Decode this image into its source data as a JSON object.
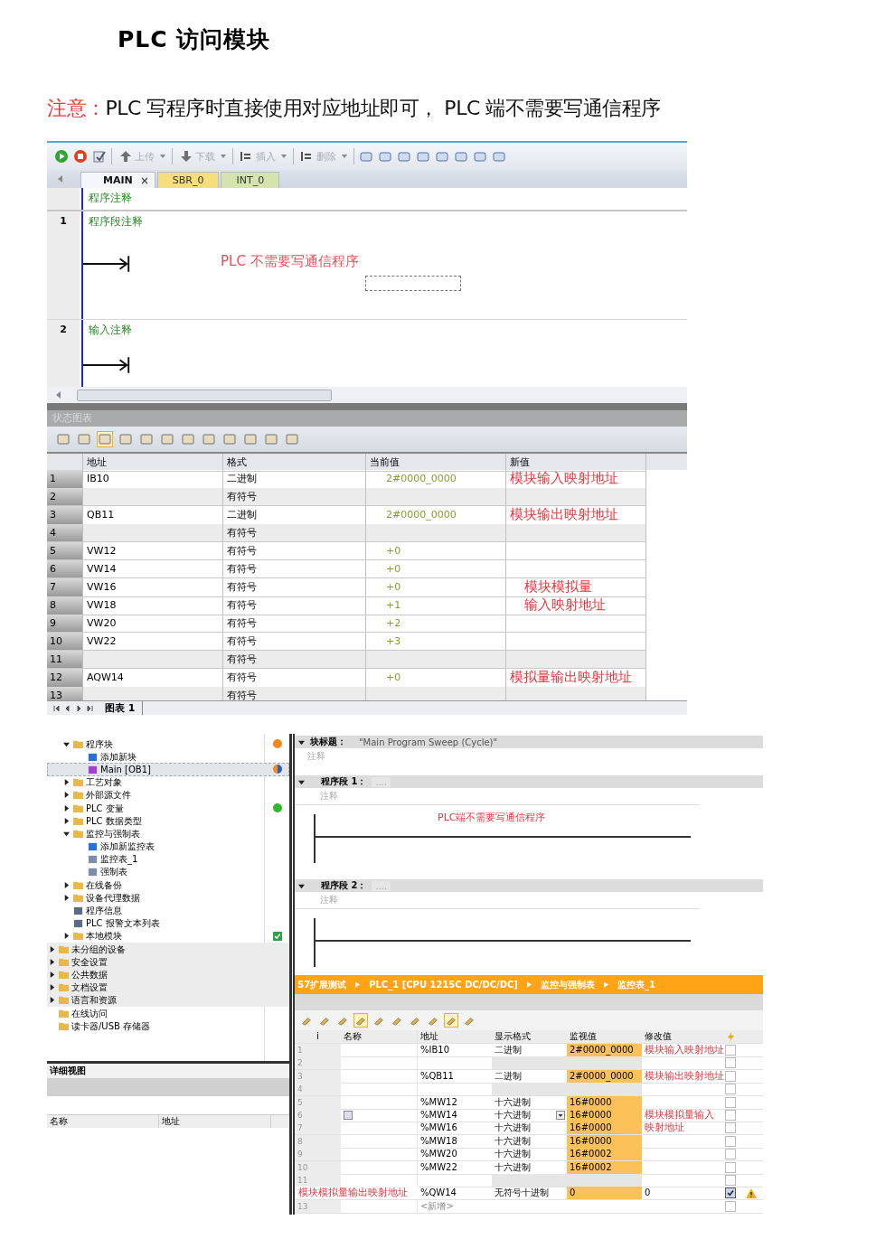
{
  "title": "PLC 访问模块",
  "note": {
    "label": "注意：",
    "text": "PLC 写程序时直接使用对应地址即可， PLC 端不需要写通信程序"
  },
  "microwin": {
    "toolbar": [
      {
        "label": "上传",
        "disabled": true
      },
      {
        "label": "下载",
        "disabled": true
      },
      {
        "label": "插入",
        "disabled": true
      },
      {
        "label": "删除",
        "disabled": true
      }
    ],
    "tabs": [
      {
        "label": "MAIN",
        "selected": true,
        "color": "#f4f6fa"
      },
      {
        "label": "SBR_0",
        "selected": false,
        "color": "#f6de7c"
      },
      {
        "label": "INT_0",
        "selected": false,
        "color": "#d3e4ad"
      }
    ],
    "program_comment": "程序注释",
    "networks": [
      {
        "number": "1",
        "comment": "程序段注释",
        "annotation": "PLC 不需要写通信程序"
      },
      {
        "number": "2",
        "comment": "输入注释"
      }
    ],
    "status_chart": {
      "title": "状态图表",
      "columns": [
        "地址",
        "格式",
        "当前值",
        "新值"
      ],
      "rows": [
        {
          "number": "1",
          "address": "IB10",
          "format": "二进制",
          "value": "2#0000_0000",
          "new_value": "模块输入映射地址"
        },
        {
          "number": "2",
          "format": "有符号"
        },
        {
          "number": "3",
          "address": "QB11",
          "format": "二进制",
          "value": "2#0000_0000",
          "new_value": "模块输出映射地址"
        },
        {
          "number": "4",
          "format": "有符号"
        },
        {
          "number": "5",
          "address": "VW12",
          "format": "有符号",
          "value": "+0"
        },
        {
          "number": "6",
          "address": "VW14",
          "format": "有符号",
          "value": "+0"
        },
        {
          "number": "7",
          "address": "VW16",
          "format": "有符号",
          "value": "+0",
          "new_value": "模块模拟量"
        },
        {
          "number": "8",
          "address": "VW18",
          "format": "有符号",
          "value": "+1",
          "new_value": "输入映射地址"
        },
        {
          "number": "9",
          "address": "VW20",
          "format": "有符号",
          "value": "+2"
        },
        {
          "number": "10",
          "address": "VW22",
          "format": "有符号",
          "value": "+3"
        },
        {
          "number": "11",
          "format": "有符号"
        },
        {
          "number": "12",
          "address": "AQW14",
          "format": "有符号",
          "value": "+0",
          "new_value": "模拟量输出映射地址"
        },
        {
          "number": "13",
          "format": "有符号"
        }
      ],
      "sheet_tab": "图表 1"
    }
  },
  "tia": {
    "plc_tree": [
      {
        "label": "程序块",
        "kind": "folder",
        "expanded": true,
        "selected": false,
        "color": "#f08a1c",
        "children": [
          {
            "label": "添加新块",
            "kind": "add",
            "selected": false
          },
          {
            "label": "Main [OB1]",
            "kind": "block",
            "selected": true,
            "color": "#2a5fc4",
            "split": true
          }
        ]
      },
      {
        "label": "工艺对象",
        "kind": "folder",
        "expanded": false,
        "selected": false
      },
      {
        "label": "外部源文件",
        "kind": "folder",
        "expanded": false,
        "selected": false
      },
      {
        "label": "PLC 变量",
        "kind": "folder",
        "expanded": false,
        "selected": false,
        "color": "#2eb82e"
      },
      {
        "label": "PLC 数据类型",
        "kind": "folder",
        "expanded": false,
        "selected": false
      },
      {
        "label": "监控与强制表",
        "kind": "folder",
        "expanded": true,
        "selected": false,
        "children": [
          {
            "label": "添加新监控表",
            "kind": "add",
            "selected": false
          },
          {
            "label": "监控表_1",
            "kind": "table",
            "selected": false
          },
          {
            "label": "强制表",
            "kind": "table",
            "selected": false
          }
        ]
      },
      {
        "label": "在线备份",
        "kind": "folder",
        "expanded": false,
        "selected": false
      },
      {
        "label": "设备代理数据",
        "kind": "folder",
        "expanded": false,
        "selected": false
      },
      {
        "label": "程序信息",
        "kind": "info",
        "selected": false
      },
      {
        "label": "PLC 报警文本列表",
        "kind": "info",
        "selected": false
      },
      {
        "label": "本地模块",
        "kind": "folder",
        "expanded": false,
        "selected": false,
        "checked": true
      }
    ],
    "project_tree": [
      {
        "label": "未分组的设备",
        "kind": "folder",
        "expanded": false,
        "selected": false
      },
      {
        "label": "安全设置",
        "kind": "folder",
        "expanded": false,
        "selected": false
      },
      {
        "label": "公共数据",
        "kind": "folder",
        "expanded": false,
        "selected": false
      },
      {
        "label": "文档设置",
        "kind": "folder",
        "expanded": false,
        "selected": false
      },
      {
        "label": "语言和资源",
        "kind": "folder",
        "expanded": false,
        "selected": false
      },
      {
        "label": "在线访问",
        "kind": "folder",
        "selected": false
      },
      {
        "label": "读卡器/USB 存储器",
        "kind": "folder",
        "selected": false
      }
    ],
    "detail_view": {
      "title": "详细视图",
      "columns": [
        "名称",
        "地址"
      ]
    },
    "block": {
      "label": "块标题：",
      "value": "\"Main Program Sweep (Cycle)\"",
      "comment": "注释"
    },
    "segments": [
      {
        "label": "程序段 1：",
        "placeholder": "....",
        "comment": "注释",
        "annotation": "PLC端不需要写通信程序"
      },
      {
        "label": "程序段 2：",
        "placeholder": "....",
        "comment": "注释"
      }
    ],
    "breadcrumb": [
      "S7扩展测试",
      "PLC_1 [CPU 1215C DC/DC/DC]",
      "监控与强制表",
      "监控表_1"
    ],
    "watch_table": {
      "columns": [
        "i",
        "名称",
        "地址",
        "显示格式",
        "监视值",
        "修改值"
      ],
      "rows": [
        {
          "number": "1",
          "address": "%IB10",
          "format": "二进制",
          "monitor": "2#0000_0000",
          "note": "模块输入映射地址",
          "checked": false,
          "warning": false
        },
        {
          "number": "2",
          "checked": false,
          "warning": false
        },
        {
          "number": "3",
          "address": "%QB11",
          "format": "二进制",
          "monitor": "2#0000_0000",
          "note": "模块输出映射地址",
          "checked": false,
          "warning": false
        },
        {
          "number": "4",
          "checked": false,
          "warning": false
        },
        {
          "number": "5",
          "address": "%MW12",
          "format": "十六进制",
          "monitor": "16#0000",
          "checked": false,
          "warning": false
        },
        {
          "number": "6",
          "address": "%MW14",
          "format": "十六进制",
          "monitor": "16#0000",
          "note": "模块模拟量输入",
          "checked": false,
          "warning": false,
          "editing": true
        },
        {
          "number": "7",
          "address": "%MW16",
          "format": "十六进制",
          "monitor": "16#0000",
          "note": "映射地址",
          "checked": false,
          "warning": false
        },
        {
          "number": "8",
          "address": "%MW18",
          "format": "十六进制",
          "monitor": "16#0000",
          "checked": false,
          "warning": false
        },
        {
          "number": "9",
          "address": "%MW20",
          "format": "十六进制",
          "monitor": "16#0002",
          "checked": false,
          "warning": false
        },
        {
          "number": "10",
          "address": "%MW22",
          "format": "十六进制",
          "monitor": "16#0002",
          "checked": false,
          "warning": false
        },
        {
          "number": "11",
          "checked": false,
          "warning": false
        },
        {
          "name_note": "模块模拟量输出映射地址",
          "address": "%QW14",
          "format": "无符号十进制",
          "monitor": "0",
          "modify": "0",
          "checked": true,
          "warning": true
        },
        {
          "number": "13",
          "placeholder": "<新增>",
          "checked": false,
          "warning": false
        }
      ]
    }
  }
}
